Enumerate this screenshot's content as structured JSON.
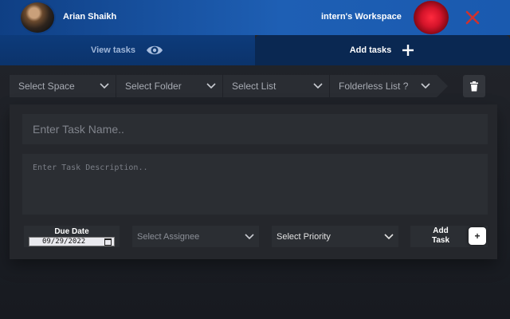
{
  "header": {
    "user_name": "Arian Shaikh",
    "workspace_name": "intern's Workspace",
    "close_icon": "close-icon",
    "accent_color": "#1e5fb4",
    "close_color": "#d0312d"
  },
  "tabs": {
    "view_label": "View tasks",
    "view_icon": "eye-icon",
    "add_label": "Add tasks",
    "add_icon": "plus-icon",
    "active": "Add tasks"
  },
  "selects": {
    "space": "Select Space",
    "folder": "Select Folder",
    "list": "Select List",
    "folderless": "Folderless List ?",
    "delete_icon": "trash-icon"
  },
  "form": {
    "task_name_placeholder": "Enter Task Name..",
    "task_desc_placeholder": "Enter Task Description..",
    "due_date_label": "Due Date",
    "due_date_value": "09/29/2022",
    "assignee_placeholder": "Select Assignee",
    "priority_placeholder": "Select Priority",
    "add_task_label": "Add Task",
    "add_task_icon": "+"
  }
}
